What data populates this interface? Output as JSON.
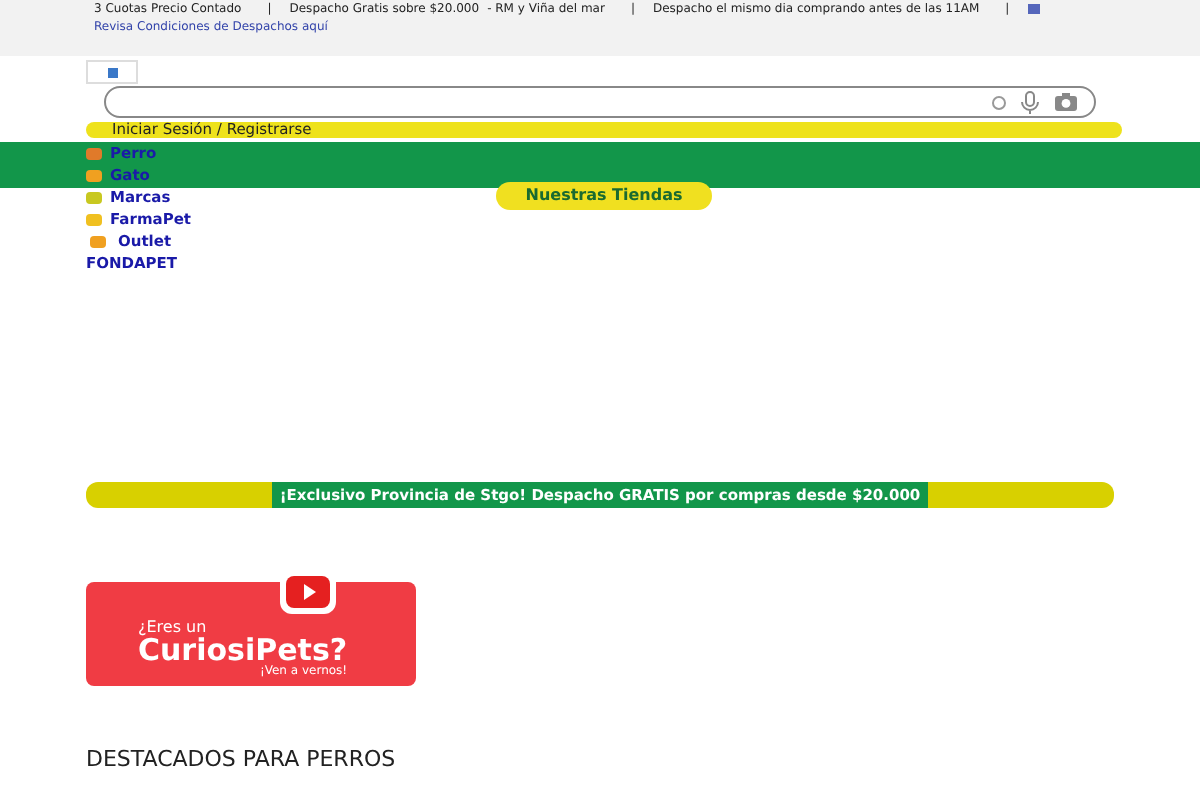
{
  "top_bar": {
    "items": [
      {
        "text": "3 Cuotas Precio Contado",
        "divider": "|"
      },
      {
        "text": "Despacho Gratis sobre $20.000"
      },
      {
        "text": "- RM y Viña del mar",
        "divider": "|"
      },
      {
        "text": "Despacho el mismo dia comprando antes de las 11AM",
        "divider": "|"
      }
    ],
    "link": "Revisa Condiciones de Despachos aquí"
  },
  "login": "Iniciar Sesión / Registrarse",
  "menu": [
    {
      "label": "Perro",
      "kind": "face"
    },
    {
      "label": "Gato",
      "kind": "cat"
    },
    {
      "label": "Marcas",
      "kind": "tag"
    },
    {
      "label": "FarmaPet",
      "kind": "pill"
    },
    {
      "label": "Outlet",
      "kind": "dollar"
    },
    {
      "label": "FONDAPET",
      "kind": "plain"
    }
  ],
  "stores_button": "Nuestras Tiendas",
  "promo_banner": "¡Exclusivo Provincia de Stgo! Despacho GRATIS por compras desde $20.000",
  "video_banner": {
    "line_1": "¿Eres un",
    "line_2": "CuriosiPets?",
    "line_3": "¡Ven a vernos!"
  },
  "section_title": "DESTACADOS PARA PERROS"
}
